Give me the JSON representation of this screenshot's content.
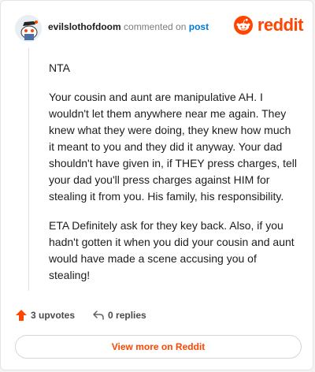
{
  "comment": {
    "username": "evilslothofdoom",
    "commented_on_text": "commented on",
    "post_link": "post",
    "paragraphs": [
      "NTA",
      "Your cousin and aunt are manipulative AH. I wouldn't let them anywhere near me again. They knew what they were doing, they knew how much it meant to you and they did it anyway. Your dad shouldn't have given in, if THEY press charges, tell your dad you'll press charges against HIM for stealing it from you. His family, his responsibility.",
      "ETA Definitely ask for they key back. Also, if you hadn't gotten it when you did your cousin and aunt would have made a scene accusing you of stealing!"
    ]
  },
  "brand": {
    "name": "reddit",
    "icon": "reddit-logo-icon",
    "color": "#ff4500"
  },
  "actions": {
    "upvotes": "3 upvotes",
    "replies": "0 replies",
    "upvote_icon": "upvote-arrow-icon",
    "reply_icon": "reply-arrow-icon"
  },
  "footer": {
    "view_more": "View more on Reddit"
  },
  "colors": {
    "accent": "#ff4500",
    "link": "#0079d3",
    "text": "#1c1c1c"
  }
}
